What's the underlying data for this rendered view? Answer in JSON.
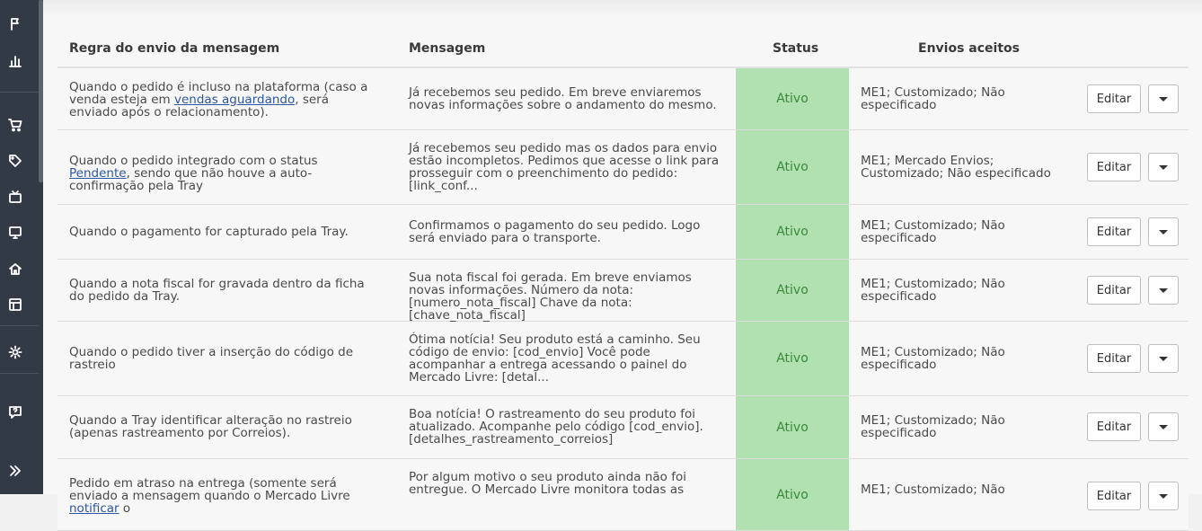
{
  "table": {
    "headers": {
      "rule": "Regra do envio da mensagem",
      "message": "Mensagem",
      "status": "Status",
      "shipping": "Envios aceitos"
    },
    "edit_label": "Editar",
    "rows": [
      {
        "rule_parts": [
          "Quando o pedido é incluso na plataforma (caso a venda esteja em ",
          "vendas aguardando",
          ", será enviado após o relacionamento)."
        ],
        "message": "Já recebemos seu pedido. Em breve enviaremos novas informações sobre o andamento do mesmo.",
        "status": "Ativo",
        "shipping": "ME1; Customizado; Não especificado"
      },
      {
        "rule_parts": [
          "Quando o pedido integrado com o status ",
          "Pendente",
          ", sendo que não houve a auto-confirmação pela Tray"
        ],
        "message": "Já recebemos seu pedido mas os dados para envio estão incompletos. Pedimos que acesse o link para prosseguir com o preenchimento do pedido: [link_conf...",
        "status": "Ativo",
        "shipping": "ME1; Mercado Envios; Customizado; Não especificado"
      },
      {
        "rule_parts": [
          "Quando o pagamento for capturado pela Tray.",
          "",
          ""
        ],
        "message": "Confirmamos o pagamento do seu pedido. Logo será enviado para o transporte.",
        "status": "Ativo",
        "shipping": "ME1; Customizado; Não especificado"
      },
      {
        "rule_parts": [
          "Quando a nota fiscal for gravada dentro da ficha do pedido da Tray.",
          "",
          ""
        ],
        "message": "Sua nota fiscal foi gerada. Em breve enviamos novas informações. Número da nota: [numero_nota_fiscal] Chave da nota: [chave_nota_fiscal]",
        "status": "Ativo",
        "shipping": "ME1; Customizado; Não especificado"
      },
      {
        "rule_parts": [
          "Quando o pedido tiver a inserção do código de rastreio",
          "",
          ""
        ],
        "message": "Ótima notícia! Seu produto está a caminho. Seu código de envio: [cod_envio] Você pode acompanhar a entrega acessando o painel do Mercado Livre: [detal...",
        "status": "Ativo",
        "shipping": "ME1; Customizado; Não especificado"
      },
      {
        "rule_parts": [
          "Quando a Tray identificar alteração no rastreio (apenas rastreamento por Correios).",
          "",
          ""
        ],
        "message": "Boa notícia! O rastreamento do seu produto foi atualizado. Acompanhe pelo código [cod_envio]. [detalhes_rastreamento_correios]",
        "status": "Ativo",
        "shipping": "ME1; Customizado; Não especificado"
      },
      {
        "rule_parts": [
          "Pedido em atraso na entrega (somente será enviado a mensagem quando o Mercado Livre ",
          "notificar",
          " o"
        ],
        "message": "Por algum motivo o seu produto ainda não foi entregue. O Mercado Livre monitora todas as",
        "status": "Ativo",
        "shipping": "ME1; Customizado; Não"
      }
    ]
  },
  "sidebar": {
    "icons": [
      "flag-icon",
      "bar-chart-icon",
      "cart-icon",
      "tag-icon",
      "tv-icon",
      "monitor-icon",
      "home-icon",
      "layout-icon",
      "gear-icon",
      "help-chat-icon",
      "expand-icon"
    ]
  }
}
